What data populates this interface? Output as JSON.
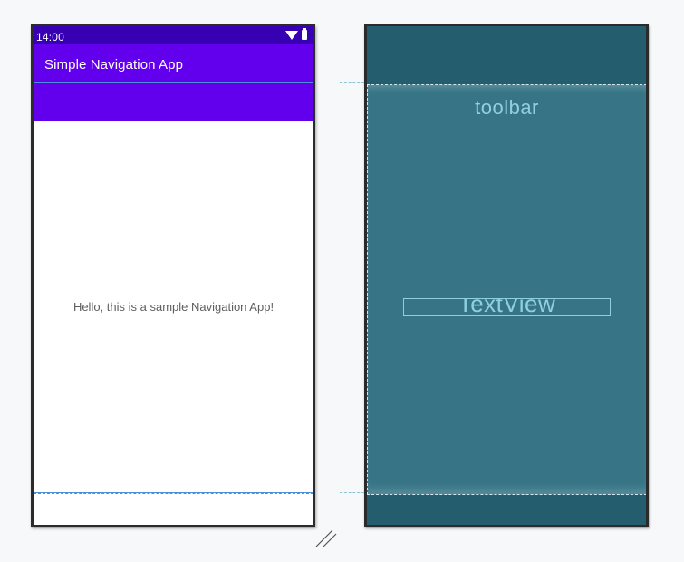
{
  "phone": {
    "status_bar": {
      "time": "14:00",
      "icons": [
        "wifi-icon",
        "battery-icon"
      ]
    },
    "app_bar": {
      "title": "Simple Navigation App"
    },
    "content": {
      "text": "Hello, this is a sample Navigation App!"
    }
  },
  "blueprint": {
    "toolbar_label": "toolbar",
    "textview_label": "TextView"
  },
  "colors": {
    "status_bar": "#3700b3",
    "primary": "#6200ee",
    "blueprint_background": "#245e6e",
    "blueprint_surface": "#377586",
    "blueprint_label": "#8fd0e0",
    "selection": "#4a8fd8"
  }
}
